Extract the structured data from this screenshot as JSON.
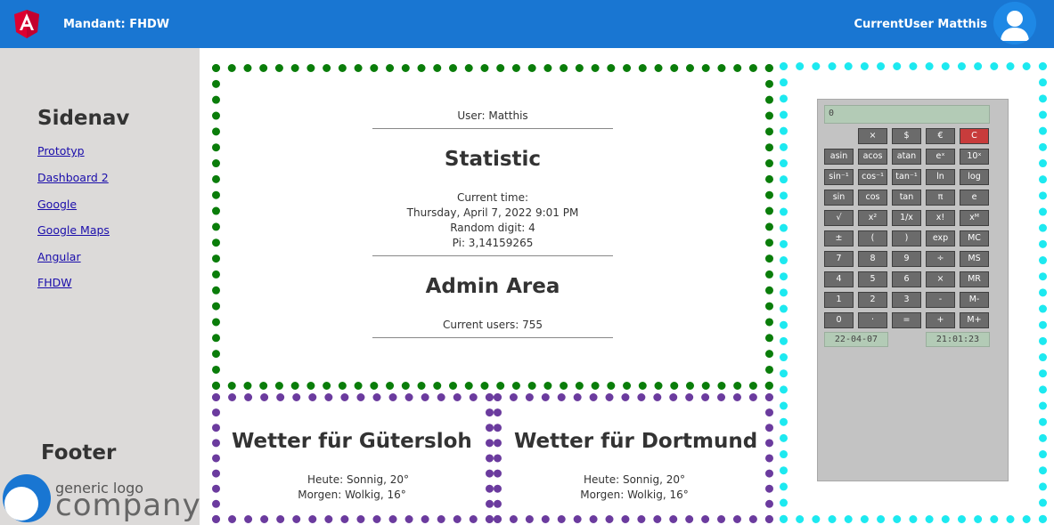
{
  "header": {
    "mandant": "Mandant: FHDW",
    "username": "CurrentUser Matthis",
    "brand_color": "#1976d2"
  },
  "sidenav": {
    "title": "Sidenav",
    "links": [
      "Prototyp",
      "Dashboard 2",
      "Google",
      "Google Maps",
      "Angular",
      "FHDW"
    ],
    "footer_title": "Footer",
    "logo_small": "generic logo",
    "logo_big": "company"
  },
  "main": {
    "user_line": "User: Matthis",
    "statistic_title": "Statistic",
    "current_time_label": "Current time:",
    "current_time_value": "Thursday, April 7, 2022 9:01 PM",
    "random_digit": "Random digit: 4",
    "pi": "Pi: 3,14159265",
    "admin_title": "Admin Area",
    "current_users": "Current users: 755"
  },
  "weather": [
    {
      "title": "Wetter für Gütersloh",
      "today": "Heute: Sonnig, 20°",
      "tomorrow": "Morgen: Wolkig, 16°"
    },
    {
      "title": "Wetter für Dortmund",
      "today": "Heute: Sonnig, 20°",
      "tomorrow": "Morgen: Wolkig, 16°"
    }
  ],
  "calculator": {
    "display": "0",
    "date": "22-04-07",
    "time": "21:01:23",
    "rows": [
      [
        "",
        "×",
        "$",
        "€",
        "C"
      ],
      [
        "asin",
        "acos",
        "atan",
        "eˣ",
        "10ˣ"
      ],
      [
        "sin⁻¹",
        "cos⁻¹",
        "tan⁻¹",
        "ln",
        "log"
      ],
      [
        "sin",
        "cos",
        "tan",
        "π",
        "e"
      ],
      [
        "√",
        "x²",
        "1/x",
        "x!",
        "xᴹ"
      ],
      [
        "±",
        "(",
        ")",
        "exp",
        "MC"
      ],
      [
        "7",
        "8",
        "9",
        "÷",
        "MS"
      ],
      [
        "4",
        "5",
        "6",
        "×",
        "MR"
      ],
      [
        "1",
        "2",
        "3",
        "-",
        "M-"
      ],
      [
        "0",
        "·",
        "=",
        "+",
        "M+"
      ]
    ]
  }
}
